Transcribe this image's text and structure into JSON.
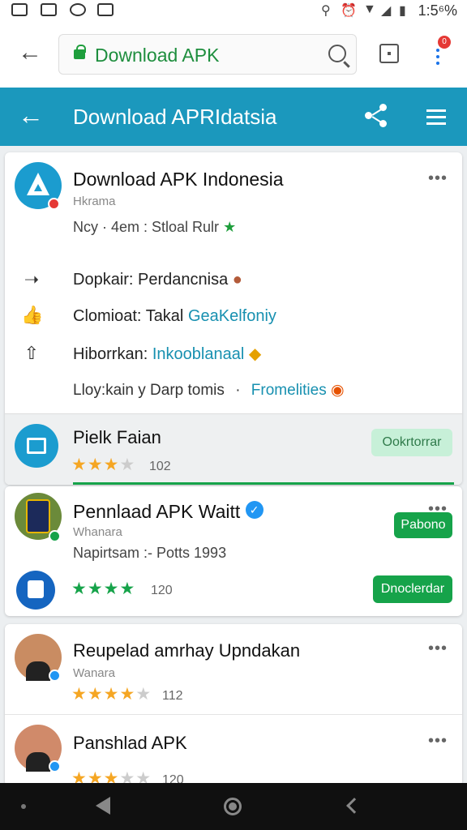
{
  "status_bar": {
    "time": "1:5⁶%",
    "left_icons": [
      "gallery-icon",
      "camera-icon",
      "sync-icon",
      "mail-icon"
    ],
    "right_icons": [
      "location-icon",
      "alarm-icon",
      "wifi-icon",
      "signal-icon",
      "battery-icon"
    ]
  },
  "browser": {
    "url": "Download APK",
    "notification_count": "0"
  },
  "app_bar": {
    "title": "Download APRIdatsia"
  },
  "card1": {
    "title": "Download APK Indonesia",
    "subtitle": "Hkrama",
    "meta": "Ncy · 4em :  Stloal Rulr",
    "rows": [
      {
        "label": "Dopkair:",
        "value": "Perdancnisa",
        "icon": "share-arrow-icon"
      },
      {
        "label": "Clomioat:",
        "value": "Takal",
        "link": "GeaKelfoniy",
        "icon": "thumbs-up-icon"
      },
      {
        "label": "Hiborrkan:",
        "link": "Inkooblanaal",
        "icon": "upload-icon"
      }
    ],
    "footer_text": "Lloy:kain  y Darp tomis",
    "footer_sep": "·",
    "footer_link": "Fromelities"
  },
  "card1_sub": {
    "title": "Pielk Faian",
    "rating": 3,
    "count": "102",
    "button": "Ookrtorrar"
  },
  "card2": {
    "title": "Pennlaad APK Waitt",
    "subtitle": "Whanara",
    "meta": "Napirtsam :-  Potts 1993",
    "small_button": "Pabono",
    "rating": 4,
    "count": "120",
    "button": "Dnoclerdar"
  },
  "card3": {
    "title": "Reupelad amrhay Upndakan",
    "subtitle": "Wanara",
    "rating": 4,
    "count": "112"
  },
  "card4": {
    "title": "Panshlad APK",
    "rating": 3,
    "count": "120"
  },
  "colors": {
    "app_bar": "#1b98bd",
    "accent_green": "#16a34a",
    "star": "#f5a623",
    "link": "#1790b0"
  }
}
